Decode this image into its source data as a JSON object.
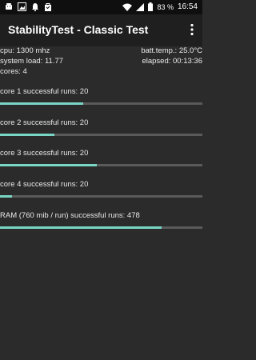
{
  "status_bar": {
    "battery_percent": "83 %",
    "time": "16:54",
    "left_icons": [
      "android-icon",
      "image-icon",
      "notification-bell-icon",
      "shopping-bag-icon"
    ],
    "right_icons": [
      "wifi-icon",
      "signal-icon",
      "battery-icon"
    ]
  },
  "app_bar": {
    "title": "StabilityTest - Classic Test",
    "menu_icon": "overflow-menu-icon"
  },
  "info": {
    "cpu": "cpu: 1300 mhz",
    "batt_temp": "batt.temp.: 25.0°C",
    "system_load": "system load: 11.77",
    "elapsed": "elapsed: 00:13:36",
    "cores": "cores: 4"
  },
  "tests": [
    {
      "label": "core 1 successful runs: 20",
      "progress": 0.41
    },
    {
      "label": "core 2 successful runs: 20",
      "progress": 0.27
    },
    {
      "label": "core 3 successful runs: 20",
      "progress": 0.48
    },
    {
      "label": "core 4 successful runs: 20",
      "progress": 0.06
    },
    {
      "label": "RAM (760 mib / run) successful runs: 478",
      "progress": 0.8
    }
  ],
  "colors": {
    "accent": "#79d6c5",
    "background": "#2b2b2b",
    "track": "#5a5a5a",
    "app_bar": "#1f1f1f",
    "status_bar": "#0f0f0f"
  }
}
